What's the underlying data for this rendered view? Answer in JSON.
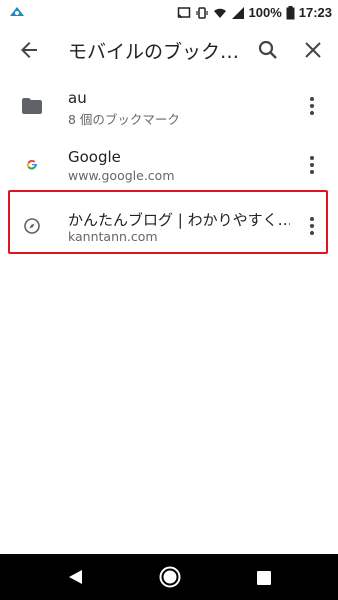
{
  "status_bar": {
    "battery_percent": "100%",
    "time": "17:23",
    "icons": [
      "app-notification-icon",
      "cast-icon",
      "vibrate-icon",
      "wifi-icon",
      "signal-icon",
      "battery-icon"
    ]
  },
  "toolbar": {
    "title": "モバイルのブック…",
    "back_icon": "arrow-back-icon",
    "search_icon": "search-icon",
    "close_icon": "close-icon"
  },
  "bookmarks": [
    {
      "title": "au",
      "subtitle": "8 個のブックマーク",
      "icon": "folder-icon"
    },
    {
      "title": "Google",
      "subtitle": "www.google.com",
      "icon": "google-favicon-icon"
    },
    {
      "title": "かんたんブログ | わかりやすく…",
      "subtitle": "kanntann.com",
      "icon": "compass-icon"
    }
  ],
  "colors": {
    "highlight": "#e0141e",
    "text_primary": "#222222",
    "text_secondary": "#666666",
    "nav_bar": "#000000"
  }
}
